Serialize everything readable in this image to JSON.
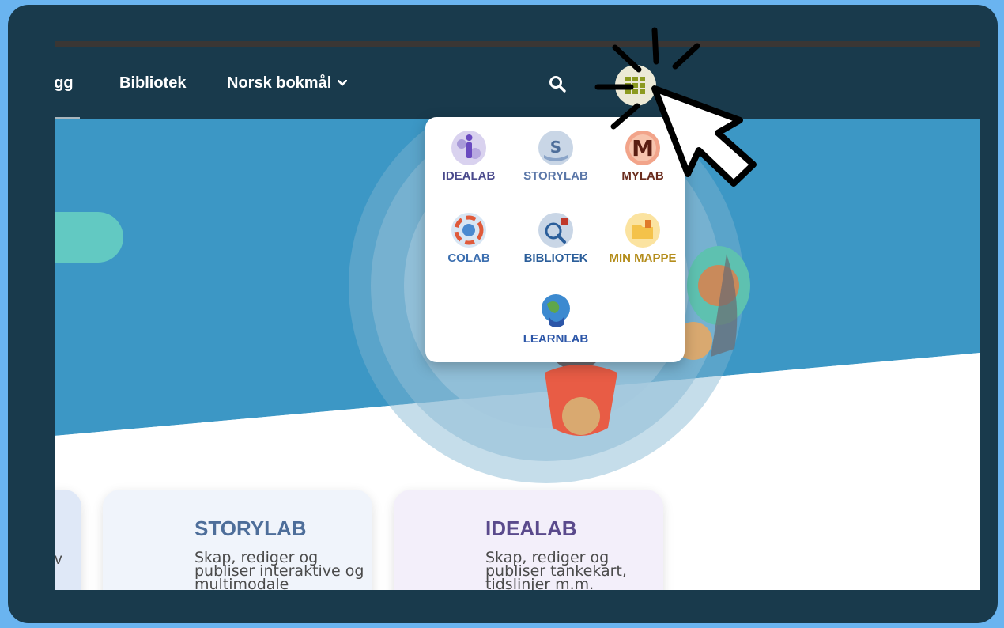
{
  "nav": {
    "items": [
      "ogg",
      "Bibliotek",
      "Norsk bokmål"
    ],
    "language_chevron": "⌄"
  },
  "icons": {
    "search": "search-icon",
    "apps": "app-grid-icon",
    "cursor": "hand-cursor-click-icon"
  },
  "apps_menu": {
    "items": [
      {
        "label": "IDEALAB",
        "color": "#4a4a8c"
      },
      {
        "label": "STORYLAB",
        "color": "#5b77a8"
      },
      {
        "label": "MYLAB",
        "color": "#6b2d1e"
      },
      {
        "label": "COLAB",
        "color": "#3c6fb0"
      },
      {
        "label": "BIBLIOTEK",
        "color": "#2b5e9a"
      },
      {
        "label": "MIN MAPPE",
        "color": "#b48d1c"
      },
      {
        "label": "LEARNLAB",
        "color": "#2c56a8"
      }
    ]
  },
  "cards": {
    "left_partial_text": "v",
    "storylab": {
      "title": "STORYLAB",
      "text": "Skap, rediger og publiser interaktive og multimodale"
    },
    "idealab": {
      "title": "IDEALAB",
      "text": "Skap, rediger og publiser tankekart, tidslinjer m.m."
    }
  },
  "colors": {
    "frame": "#193a4c",
    "background": "#6ab4f0",
    "hero_blue": "#3c97c5",
    "teal_button": "#62c9c2"
  }
}
